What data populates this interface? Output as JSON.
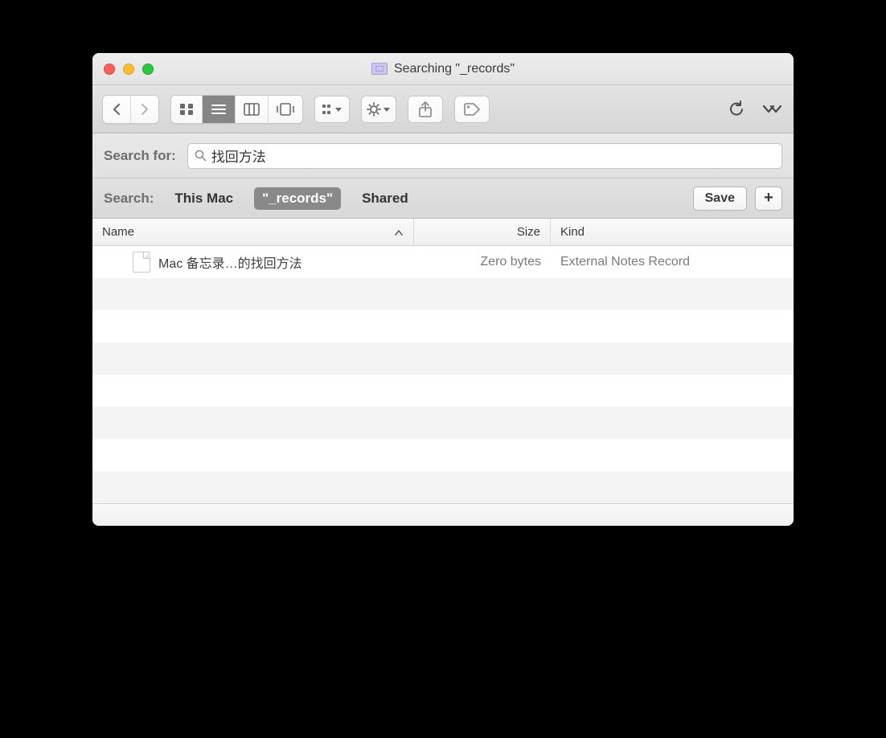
{
  "title": "Searching \"_records\"",
  "toolbar": {
    "view_modes": [
      "icon",
      "list",
      "column",
      "gallery"
    ],
    "active_view": "list"
  },
  "search_for": {
    "label": "Search for:",
    "value": "找回方法"
  },
  "scope": {
    "label": "Search:",
    "options": [
      {
        "label": "This Mac",
        "active": false
      },
      {
        "label": "\"_records\"",
        "active": true
      },
      {
        "label": "Shared",
        "active": false
      }
    ],
    "save_label": "Save",
    "plus_label": "+"
  },
  "columns": {
    "name": "Name",
    "size": "Size",
    "kind": "Kind"
  },
  "rows": [
    {
      "name": "Mac 备忘录…的找回方法",
      "size": "Zero bytes",
      "kind": "External Notes Record"
    }
  ]
}
